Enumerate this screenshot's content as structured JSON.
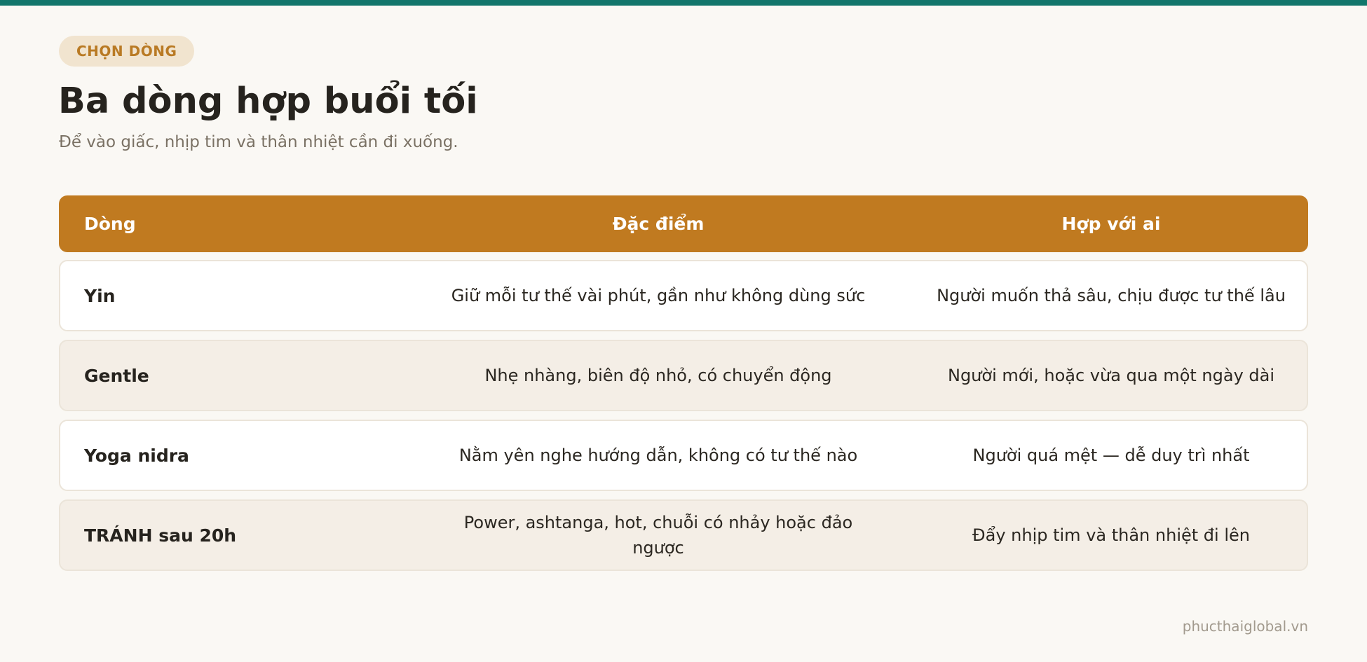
{
  "badge": "CHỌN DÒNG",
  "title": "Ba dòng hợp buổi tối",
  "subtitle": "Để vào giấc, nhịp tim và thân nhiệt cần đi xuống.",
  "table": {
    "headers": [
      "Dòng",
      "Đặc điểm",
      "Hợp với ai"
    ],
    "rows": [
      {
        "name": "Yin",
        "feature": "Giữ mỗi tư thế vài phút, gần như không dùng sức",
        "suited": "Người muốn thả sâu, chịu được tư thế lâu"
      },
      {
        "name": "Gentle",
        "feature": "Nhẹ nhàng, biên độ nhỏ, có chuyển động",
        "suited": "Người mới, hoặc vừa qua một ngày dài"
      },
      {
        "name": "Yoga nidra",
        "feature": "Nằm yên nghe hướng dẫn, không có tư thế nào",
        "suited": "Người quá mệt — dễ duy trì nhất"
      },
      {
        "name": "TRÁNH sau 20h",
        "feature": "Power, ashtanga, hot, chuỗi có nhảy hoặc đảo ngược",
        "suited": "Đẩy nhịp tim và thân nhiệt đi lên"
      }
    ]
  },
  "footer": "phucthaiglobal.vn",
  "colors": {
    "accent_top": "#12766b",
    "header_bg": "#c07a20",
    "badge_bg": "#f1e4cf",
    "badge_text": "#b97a24"
  }
}
